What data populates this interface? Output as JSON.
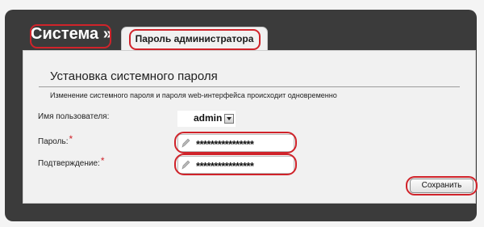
{
  "header": {
    "title": "Система »",
    "tab_label": "Пароль администратора"
  },
  "section": {
    "title": "Установка системного пароля",
    "description": "Изменение системного пароля и пароля web-интерфейса происходит одновременно"
  },
  "form": {
    "username": {
      "label": "Имя пользователя:",
      "selected_value": "admin"
    },
    "password": {
      "label": "Пароль:",
      "value": "****************",
      "required_mark": "*"
    },
    "confirm": {
      "label": "Подтверждение:",
      "value": "****************",
      "required_mark": "*"
    }
  },
  "actions": {
    "save_label": "Сохранить"
  },
  "icons": {
    "field_edit": "pencil-icon",
    "dropdown": "chevron-down-icon"
  },
  "colors": {
    "highlight": "#d0232a",
    "header_bg": "#3b3b3b"
  }
}
